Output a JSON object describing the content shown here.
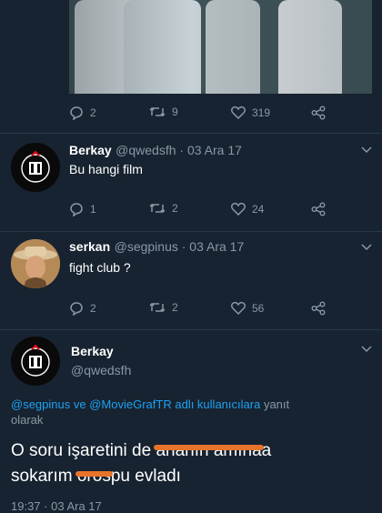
{
  "tweet0": {
    "replies": "2",
    "retweets": "9",
    "likes": "319"
  },
  "tweet1": {
    "name": "Berkay",
    "handle": "@qwedsfh · 03 Ara 17",
    "text": "Bu hangi film",
    "replies": "1",
    "retweets": "2",
    "likes": "24"
  },
  "tweet2": {
    "name": "serkan",
    "handle": "@segpinus · 03 Ara 17",
    "text": "fight club ?",
    "replies": "2",
    "retweets": "2",
    "likes": "56"
  },
  "main": {
    "name": "Berkay",
    "handle": "@qwedsfh",
    "mention1": "@segpinus",
    "reply_and": "ve",
    "mention2": "@MovieGrafTR",
    "reply_suffix": "adlı kullanıcılara",
    "reply_word": "yanıt",
    "reply_end": "olarak",
    "line1_a": "O soru işaretini de",
    "line1_censored": "ananın amına",
    "line1_end": "a",
    "line2_a": "sokarım",
    "line2_censored": "oros",
    "line2_b": "pu evladı",
    "timestamp": "19:37 · 03 Ara 17"
  },
  "colors": {
    "background": "#172330",
    "link": "#1da1f2",
    "muted": "#8899a6",
    "censor": "#e8732a"
  }
}
